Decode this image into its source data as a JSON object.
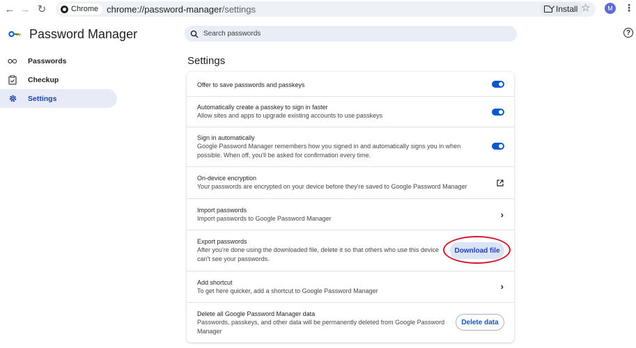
{
  "browser": {
    "chip_label": "Chrome",
    "url_host": "chrome://password-manager",
    "url_path": "/settings",
    "install_label": "Install",
    "avatar_initial": "M"
  },
  "header": {
    "app_title": "Password Manager",
    "search_placeholder": "Search passwords"
  },
  "sidebar": {
    "items": [
      {
        "label": "Passwords",
        "icon": "key-icon",
        "active": false
      },
      {
        "label": "Checkup",
        "icon": "clipboard-check-icon",
        "active": false
      },
      {
        "label": "Settings",
        "icon": "gear-icon",
        "active": true
      }
    ]
  },
  "main": {
    "title": "Settings",
    "rows": [
      {
        "title": "Offer to save passwords and passkeys",
        "control": "toggle",
        "on": true
      },
      {
        "title": "Automatically create a passkey to sign in faster",
        "desc": "Allow sites and apps to upgrade existing accounts to use passkeys",
        "control": "toggle",
        "on": true
      },
      {
        "title": "Sign in automatically",
        "desc1": "Google Password Manager remembers how you signed in and automatically signs you in when",
        "desc2": "possible. When off, you'll be asked for confirmation every time.",
        "control": "toggle",
        "on": true
      },
      {
        "title": "On-device encryption",
        "desc": "Your passwords are encrypted on your device before they're saved to Google Password Manager",
        "control": "external-link-icon"
      },
      {
        "title": "Import passwords",
        "desc": "Import passwords to Google Password Manager",
        "control": "chevron-right-icon"
      },
      {
        "title": "Export passwords",
        "desc1": "After you're done using the downloaded file, delete it so that others who use this device",
        "desc2": "can't see your passwords.",
        "button": "Download file"
      },
      {
        "title": "Add shortcut",
        "desc": "To get here quicker, add a shortcut to Google Password Manager",
        "control": "chevron-right-icon"
      },
      {
        "title": "Delete all Google Password Manager data",
        "desc1": "Passwords, passkeys, and other data will be permanently deleted from Google Password",
        "desc2": "Manager",
        "button": "Delete data"
      }
    ]
  },
  "colors": {
    "accent": "#0b57d0",
    "active_nav_bg": "#e6ebf7",
    "highlight_ring": "#d6162b"
  }
}
